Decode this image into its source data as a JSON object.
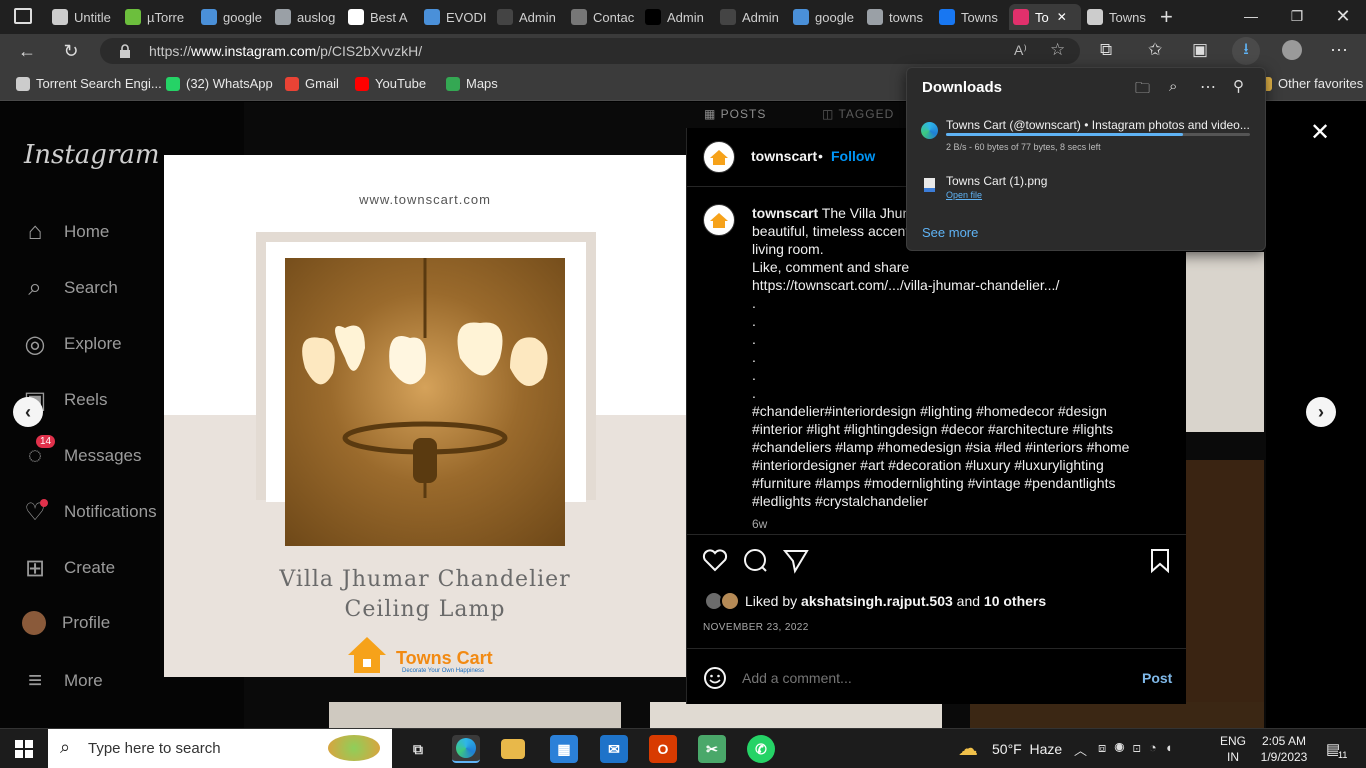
{
  "browser": {
    "tabs": [
      {
        "label": "Untitle",
        "icon": "page-icon",
        "color": "#cccccc"
      },
      {
        "label": "µTorre",
        "icon": "utorrent-icon",
        "color": "#6cbf3d"
      },
      {
        "label": "google",
        "icon": "search-icon",
        "color": "#4a90d9"
      },
      {
        "label": "auslog",
        "icon": "google-icon",
        "color": "#9aa0a6"
      },
      {
        "label": "Best A",
        "icon": "amazon-icon",
        "color": "#ffffff"
      },
      {
        "label": "EVODI",
        "icon": "search-icon",
        "color": "#4a90d9"
      },
      {
        "label": "Admin",
        "icon": "q-icon",
        "color": "#444444"
      },
      {
        "label": "Contac",
        "icon": "chart-icon",
        "color": "#777777"
      },
      {
        "label": "Admin",
        "icon": "q-icon",
        "color": "#000000"
      },
      {
        "label": "Admin",
        "icon": "q-icon",
        "color": "#444444"
      },
      {
        "label": "google",
        "icon": "search-icon",
        "color": "#4a90d9"
      },
      {
        "label": "towns",
        "icon": "google-icon",
        "color": "#9aa0a6"
      },
      {
        "label": "Towns",
        "icon": "facebook-icon",
        "color": "#1877f2"
      },
      {
        "label": "To",
        "icon": "instagram-icon",
        "color": "#e1306c"
      },
      {
        "label": "Towns",
        "icon": "page-icon",
        "color": "#cccccc"
      }
    ],
    "url_prefix": "https://",
    "url_host": "www.instagram.com",
    "url_path": "/p/CIS2bXvvzkH/",
    "favorites": [
      {
        "label": "Torrent Search Engi...",
        "icon": "page-icon",
        "color": "#cccccc"
      },
      {
        "label": "(32) WhatsApp",
        "icon": "whatsapp-icon",
        "color": "#25d366"
      },
      {
        "label": "Gmail",
        "icon": "gmail-icon",
        "color": "#ea4335"
      },
      {
        "label": "YouTube",
        "icon": "youtube-icon",
        "color": "#ff0000"
      },
      {
        "label": "Maps",
        "icon": "maps-icon",
        "color": "#34a853"
      }
    ],
    "other_favorites": "Other favorites"
  },
  "downloads": {
    "title": "Downloads",
    "items": [
      {
        "name": "Towns Cart (@townscart) • Instagram photos and video...",
        "status": "2 B/s - 60 bytes of 77 bytes, 8 secs left",
        "progress": 0.78
      },
      {
        "name": "Towns Cart (1).png",
        "action": "Open file"
      }
    ],
    "see_more": "See more"
  },
  "instagram": {
    "logo": "Instagram",
    "nav": [
      {
        "label": "Home",
        "icon": "home-icon"
      },
      {
        "label": "Search",
        "icon": "search-icon"
      },
      {
        "label": "Explore",
        "icon": "compass-icon"
      },
      {
        "label": "Reels",
        "icon": "reels-icon"
      },
      {
        "label": "Messages",
        "icon": "messenger-icon",
        "badge": "14"
      },
      {
        "label": "Notifications",
        "icon": "heart-icon"
      },
      {
        "label": "Create",
        "icon": "plus-square-icon"
      },
      {
        "label": "Profile",
        "icon": "avatar-icon"
      },
      {
        "label": "More",
        "icon": "menu-icon"
      }
    ],
    "profile_tabs": {
      "posts": "POSTS",
      "tagged": "TAGGED"
    }
  },
  "post": {
    "image": {
      "website": "www.townscart.com",
      "title_line1": "Villa Jhumar Chandelier",
      "title_line2": "Ceiling Lamp",
      "brand": "Towns Cart",
      "brand_tagline": "Decorate Your Own Happiness"
    },
    "username": "townscart",
    "follow": "Follow",
    "caption_user": "townscart",
    "caption_lines": [
      "The Villa Jhum",
      "beautiful, timeless accent",
      "living room.",
      "Like, comment and share",
      "https://townscart.com/.../villa-jhumar-chandelier.../",
      ".",
      ".",
      ".",
      ".",
      ".",
      "."
    ],
    "hashtags": [
      "#chandelier#interiordesign #lighting #homedecor #design",
      "#interior #light #lightingdesign #decor #architecture #lights",
      "#chandeliers #lamp #homedesign #sia #led #interiors #home",
      "#interiordesigner #art #decoration #luxury #luxurylighting",
      "#furniture #lamps #modernlighting #vintage #pendantlights",
      "#ledlights #crystalchandelier"
    ],
    "age": "6w",
    "liked_prefix": "Liked by ",
    "liked_user": "akshatsingh.rajput.503",
    "liked_and": " and ",
    "liked_others": "10 others",
    "date": "NOVEMBER 23, 2022",
    "comment_placeholder": "Add a comment...",
    "post_button": "Post"
  },
  "taskbar": {
    "search_placeholder": "Type here to search",
    "weather": "50°F  Haze",
    "lang1": "ENG",
    "lang2": "IN",
    "time": "2:05 AM",
    "date": "1/9/2023",
    "notifications_count": "11"
  }
}
